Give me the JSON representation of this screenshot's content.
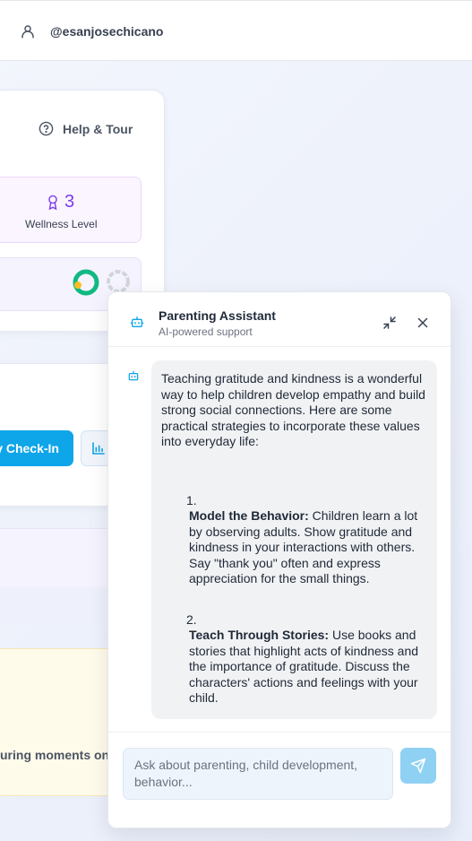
{
  "header": {
    "username": "@esanjosechicano",
    "user_icon": "user-icon"
  },
  "dashboard": {
    "help_label": "Help & Tour",
    "wellness_value": "3",
    "wellness_label": "Wellness Level",
    "checkin_label": "y Check-In",
    "bottom_card_text": "uring moments on"
  },
  "chat": {
    "title": "Parenting Assistant",
    "subtitle": "AI-powered support",
    "message_intro": "Teaching gratitude and kindness is a wonderful way to help children develop empathy and build strong social connections. Here are some practical strategies to incorporate these values into everyday life:",
    "items": [
      {
        "number": "1.",
        "heading": "Model the Behavior:",
        "text": " Children learn a lot by observing adults. Show gratitude and kindness in your interactions with others. Say \"thank you\" often and express appreciation for the small things."
      },
      {
        "number": "2.",
        "heading": "Teach Through Stories:",
        "text": " Use books and stories that highlight acts of kindness and the importance of gratitude. Discuss the characters' actions and feelings with your child."
      }
    ],
    "input_placeholder": "Ask about parenting, child development, behavior..."
  },
  "colors": {
    "accent": "#0ea5e9",
    "send_button": "#8fd1f3",
    "wellness": "#7c3aed",
    "ring_green": "#10b981"
  }
}
